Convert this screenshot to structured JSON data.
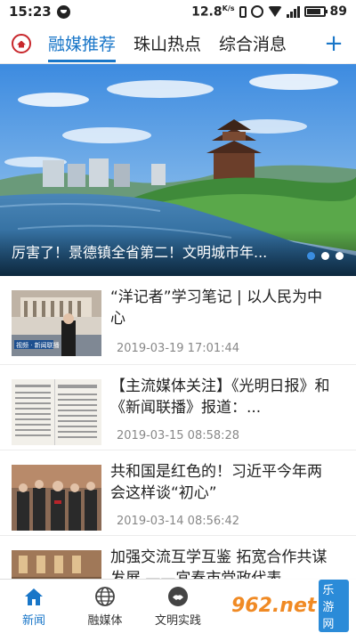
{
  "status_bar": {
    "time": "15:23",
    "speed": "12.8",
    "speed_unit": "K/s",
    "battery": "89"
  },
  "tabs": {
    "items": [
      {
        "label": "融媒推荐",
        "active": true
      },
      {
        "label": "珠山热点",
        "active": false
      },
      {
        "label": "综合消息",
        "active": false
      }
    ],
    "add_label": "+"
  },
  "banner": {
    "caption": "厉害了！景德镇全省第二！文明城市年...",
    "dots": 3,
    "active_dot": 0
  },
  "news": [
    {
      "title": "“洋记者”学习笔记 | 以人民为中心",
      "time": "2019-03-19 17:01:44",
      "thumb_text": "视频 · 新闻联播"
    },
    {
      "title": "【主流媒体关注】《光明日报》和《新闻联播》报道：...",
      "time": "2019-03-15 08:58:28",
      "thumb_text": ""
    },
    {
      "title": "共和国是红色的！习近平今年两会这样谈“初心”",
      "time": "2019-03-14 08:56:42",
      "thumb_text": ""
    },
    {
      "title": "加强交流互学互鉴 拓宽合作共谋发展 ——宜春市党政代表...",
      "time": "",
      "thumb_text": ""
    }
  ],
  "bottom_nav": [
    {
      "label": "新闻",
      "icon": "home-icon",
      "active": true
    },
    {
      "label": "融媒体",
      "icon": "globe-icon",
      "active": false
    },
    {
      "label": "文明实践",
      "icon": "handshake-icon",
      "active": false
    }
  ],
  "watermark": {
    "text": "962.net",
    "sub": "乐游网"
  },
  "colors": {
    "accent": "#1976c8",
    "logo_red": "#c8272c"
  }
}
